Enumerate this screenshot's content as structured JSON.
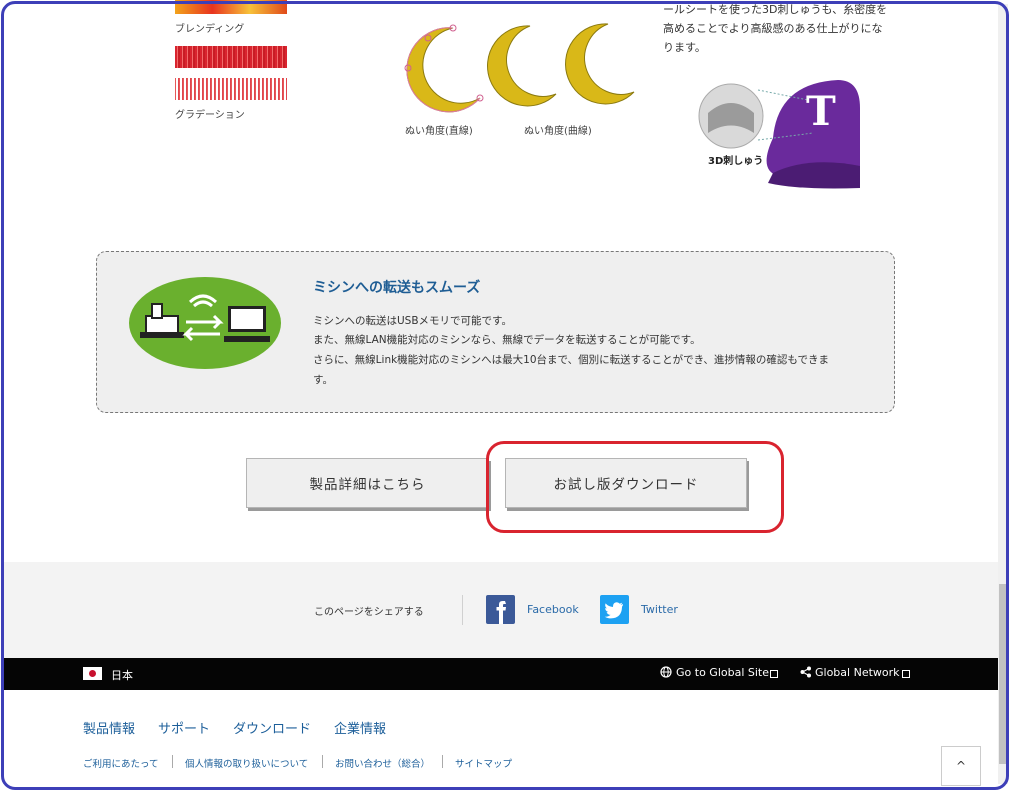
{
  "features": {
    "blending_label": "ブレンディング",
    "gradation_label": "グラデーション",
    "angle_straight_label": "ぬい角度(直線)",
    "angle_curve_label": "ぬい角度(曲線)",
    "text_line1": "ールシートを使った3D刺しゅうも、糸密度を",
    "text_line2": "高めることでより高級感のある仕上がりにな",
    "text_line3": "ります。",
    "cap_label": "3D刺しゅう",
    "cap_letter": "T"
  },
  "info": {
    "title": "ミシンへの転送もスムーズ",
    "line1": "ミシンへの転送はUSBメモリで可能です。",
    "line2": "また、無線LAN機能対応のミシンなら、無線でデータを転送することが可能です。",
    "line3": "さらに、無線Link機能対応のミシンへは最大10台まで、個別に転送することができ、進捗情報の確認もできま",
    "line4": "す。"
  },
  "buttons": {
    "details": "製品詳細はこちら",
    "trial": "お試し版ダウンロード"
  },
  "share": {
    "text": "このページをシェアする",
    "facebook": "Facebook",
    "twitter": "Twitter"
  },
  "bar": {
    "country": "日本",
    "global_site": "Go to Global Site",
    "global_network": "Global Network"
  },
  "footer": {
    "nav": [
      "製品情報",
      "サポート",
      "ダウンロード",
      "企業情報"
    ],
    "sub": [
      "ご利用にあたって",
      "個人情報の取り扱いについて",
      "お問い合わせ（総合）",
      "サイトマップ"
    ]
  },
  "to_top_label": "^",
  "colors": {
    "accent_blue": "#1e5d94",
    "highlight_red": "#d9242f",
    "facebook": "#3b5998",
    "twitter": "#1da1f2",
    "illustration_green": "#6ab02e"
  }
}
